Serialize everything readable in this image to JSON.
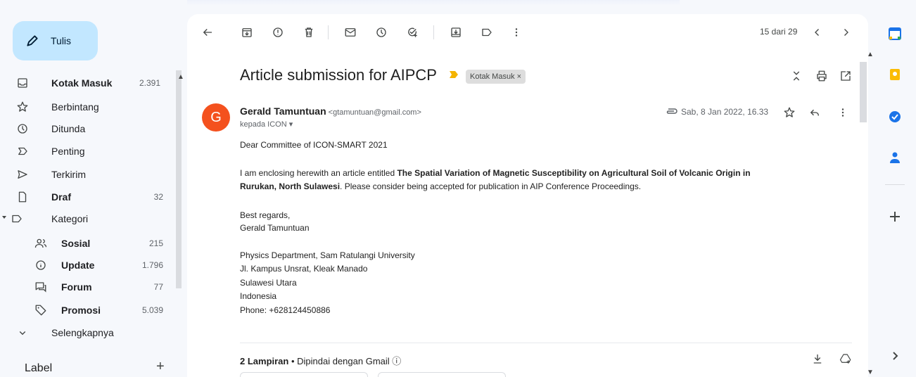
{
  "compose": {
    "label": "Tulis"
  },
  "nav": [
    {
      "label": "Kotak Masuk",
      "count": "2.391",
      "icon": "inbox-icon",
      "bold": true
    },
    {
      "label": "Berbintang",
      "count": "",
      "icon": "star-icon"
    },
    {
      "label": "Ditunda",
      "count": "",
      "icon": "clock-icon"
    },
    {
      "label": "Penting",
      "count": "",
      "icon": "important-icon"
    },
    {
      "label": "Terkirim",
      "count": "",
      "icon": "send-icon"
    },
    {
      "label": "Draf",
      "count": "32",
      "icon": "file-icon",
      "bold": true
    },
    {
      "label": "Kategori",
      "count": "",
      "icon": "label-icon"
    },
    {
      "label": "Sosial",
      "count": "215",
      "icon": "people-icon",
      "bold": true
    },
    {
      "label": "Update",
      "count": "1.796",
      "icon": "info-icon",
      "bold": true
    },
    {
      "label": "Forum",
      "count": "77",
      "icon": "forum-icon",
      "bold": true
    },
    {
      "label": "Promosi",
      "count": "5.039",
      "icon": "tag-icon",
      "bold": true
    },
    {
      "label": "Selengkapnya",
      "count": "",
      "icon": "chevron-down-icon"
    }
  ],
  "labels": {
    "heading": "Label",
    "add": "+"
  },
  "toolbar": {
    "pager": "15 dari 29"
  },
  "message": {
    "subject": "Article submission for AIPCP",
    "label_chip": "Kotak Masuk ×",
    "avatar_letter": "G",
    "sender_name": "Gerald Tamuntuan",
    "sender_email": "<gtamuntuan@gmail.com>",
    "to": "kepada ICON ▾",
    "date": "Sab, 8 Jan 2022, 16.33",
    "greeting": "Dear Committee of ICON-SMART 2021",
    "para_pre": "I am enclosing herewith an article entitled ",
    "para_title_1": "The Spatial Variation of Magnetic Susceptibility on Agricultural Soil of Volcanic Origin in",
    "para_title_2": "Rurukan, North Sulawesi",
    "para_post": ". Please consider being accepted for publication in AIP Conference Proceedings.",
    "regards": "Best regards,",
    "sig_name": "Gerald Tamuntuan",
    "addr1": "Physics Department, Sam Ratulangi University",
    "addr2": "Jl. Kampus Unsrat, Kleak Manado",
    "addr3": "Sulawesi Utara",
    "addr4": "Indonesia",
    "phone": "Phone: +628124450886"
  },
  "attachments": {
    "count_label": "2 Lampiran",
    "scan_label": " • Dipindai dengan Gmail ⓘ"
  },
  "colors": {
    "compose_bg": "#c2e7ff",
    "avatar": "#f4511e",
    "important": "#f4b400"
  }
}
